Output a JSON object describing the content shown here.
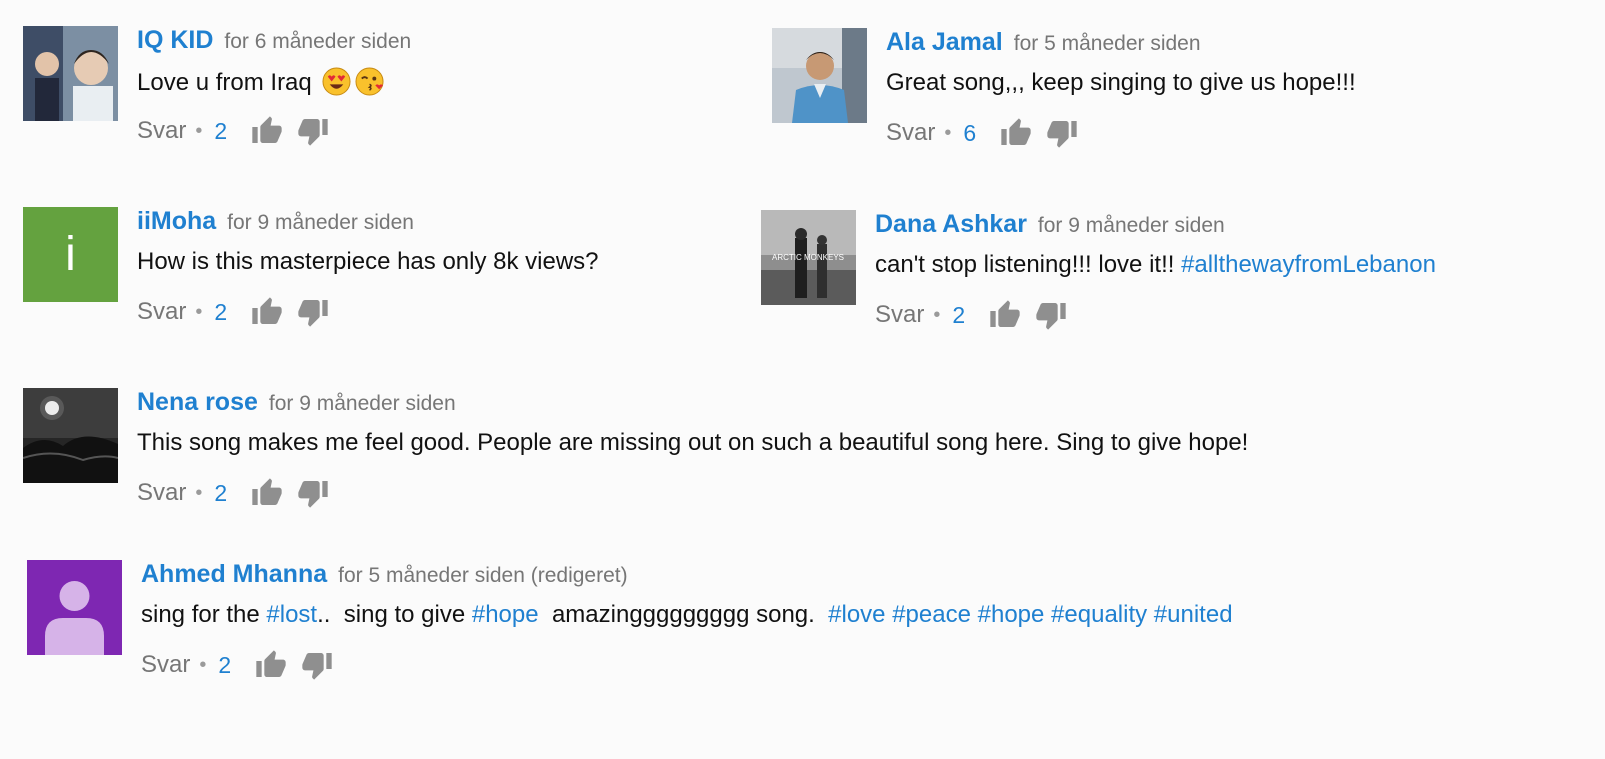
{
  "comments": [
    {
      "author": "IQ KID",
      "time": "for 6 måneder siden",
      "text": "Love u from Iraq",
      "reply": "Svar",
      "likes": "2"
    },
    {
      "author": "Ala Jamal",
      "time": "for 5 måneder siden",
      "text": "Great song,,, keep singing to give us hope!!!",
      "reply": "Svar",
      "likes": "6"
    },
    {
      "author": "iiMoha",
      "time": "for 9 måneder siden",
      "avatar_letter": "i",
      "text": "How is this masterpiece has only 8k views?",
      "reply": "Svar",
      "likes": "2"
    },
    {
      "author": "Dana Ashkar",
      "time": "for 9 måneder siden",
      "avatar_caption": "ARCTIC MONKEYS",
      "text": "can't stop listening!!! love it!!",
      "hashtags": [
        "#allthewayfromLebanon"
      ],
      "reply": "Svar",
      "likes": "2"
    },
    {
      "author": "Nena rose",
      "time": "for 9 måneder siden",
      "text": "This song makes me feel good. People are missing out on such a beautiful song here. Sing to give hope!",
      "reply": "Svar",
      "likes": "2"
    },
    {
      "author": "Ahmed Mhanna",
      "time": "for 5 måneder siden (redigeret)",
      "text_parts": [
        "sing for the ",
        "..  sing to give ",
        "  amazinggggggggg song.  "
      ],
      "hashtags": [
        "#lost",
        "#hope",
        "#love",
        "#peace",
        "#hope",
        "#equality",
        "#united"
      ],
      "reply": "Svar",
      "likes": "2"
    }
  ],
  "colors": {
    "accent": "#1f80d0",
    "muted": "#767676",
    "text": "#111111",
    "avatar_green": "#64a23f",
    "avatar_purple": "#7e27b2"
  },
  "icons": [
    "thumbs-up-icon",
    "thumbs-down-icon",
    "heart-eyes-emoji-icon",
    "kiss-wink-emoji-icon"
  ]
}
